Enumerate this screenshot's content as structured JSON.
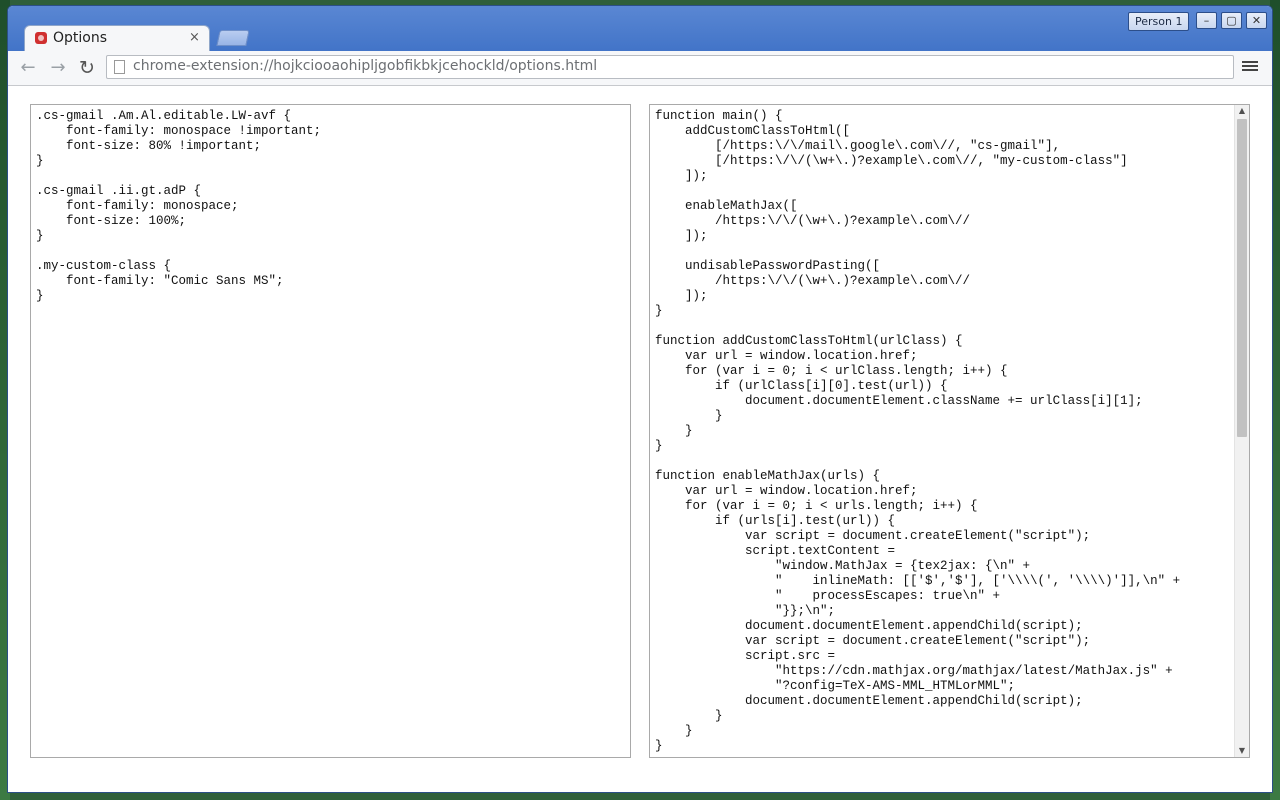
{
  "window": {
    "profile": "Person 1",
    "buttons": {
      "minimize": "–",
      "maximize": "▢",
      "close": "✕"
    }
  },
  "tab": {
    "title": "Options",
    "close": "×"
  },
  "toolbar": {
    "back": "←",
    "forward": "→",
    "reload": "↻",
    "url": "chrome-extension://hojkciooaohipljgobfikbkjcehockld/options.html"
  },
  "editors": {
    "css": ".cs-gmail .Am.Al.editable.LW-avf {\n    font-family: monospace !important;\n    font-size: 80% !important;\n}\n\n.cs-gmail .ii.gt.adP {\n    font-family: monospace;\n    font-size: 100%;\n}\n\n.my-custom-class {\n    font-family: \"Comic Sans MS\";\n}",
    "js": "function main() {\n    addCustomClassToHtml([\n        [/https:\\/\\/mail\\.google\\.com\\//, \"cs-gmail\"],\n        [/https:\\/\\/(\\w+\\.)?example\\.com\\//, \"my-custom-class\"]\n    ]);\n\n    enableMathJax([\n        /https:\\/\\/(\\w+\\.)?example\\.com\\//\n    ]);\n\n    undisablePasswordPasting([\n        /https:\\/\\/(\\w+\\.)?example\\.com\\//\n    ]);\n}\n\nfunction addCustomClassToHtml(urlClass) {\n    var url = window.location.href;\n    for (var i = 0; i < urlClass.length; i++) {\n        if (urlClass[i][0].test(url)) {\n            document.documentElement.className += urlClass[i][1];\n        }\n    }\n}\n\nfunction enableMathJax(urls) {\n    var url = window.location.href;\n    for (var i = 0; i < urls.length; i++) {\n        if (urls[i].test(url)) {\n            var script = document.createElement(\"script\");\n            script.textContent =\n                \"window.MathJax = {tex2jax: {\\n\" +\n                \"    inlineMath: [['$','$'], ['\\\\\\\\(', '\\\\\\\\)']],\\n\" +\n                \"    processEscapes: true\\n\" +\n                \"}};\\n\";\n            document.documentElement.appendChild(script);\n            var script = document.createElement(\"script\");\n            script.src =\n                \"https://cdn.mathjax.org/mathjax/latest/MathJax.js\" +\n                \"?config=TeX-AMS-MML_HTMLorMML\";\n            document.documentElement.appendChild(script);\n        }\n    }\n}"
  },
  "scrollbar": {
    "up": "▲",
    "down": "▼"
  }
}
